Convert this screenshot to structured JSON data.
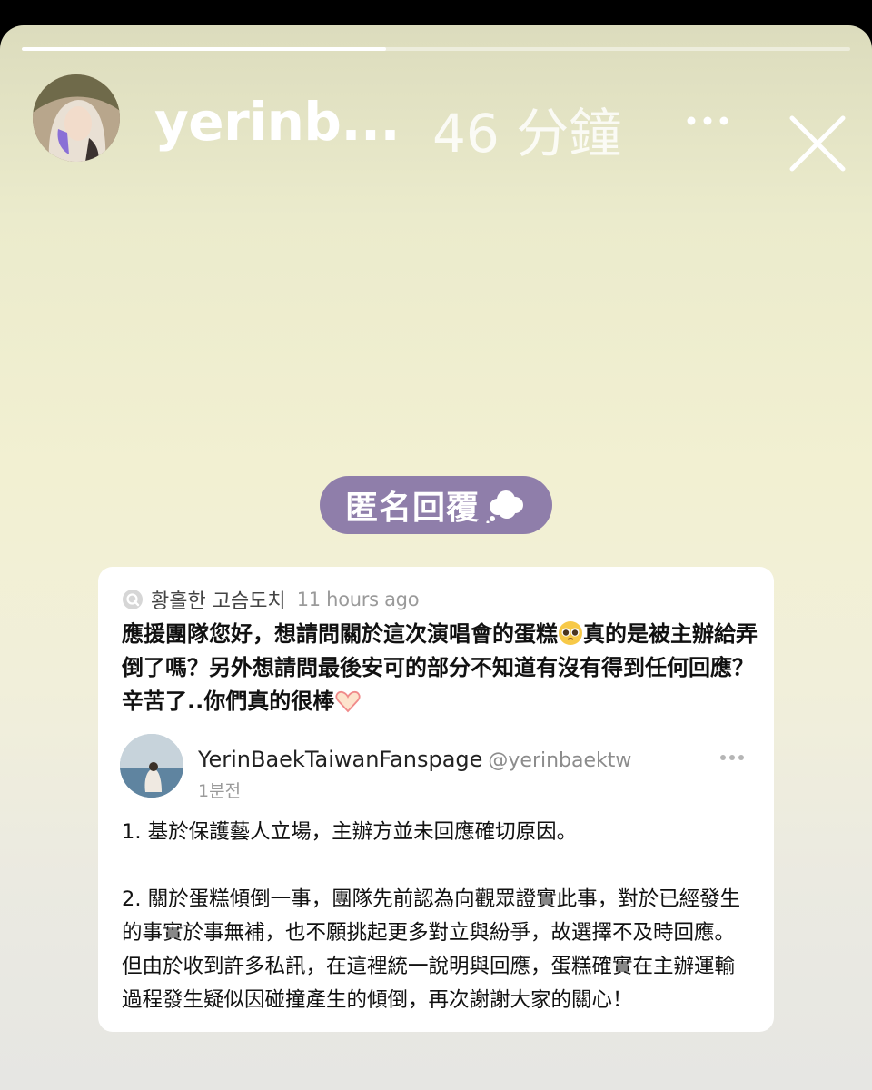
{
  "story": {
    "progress": 0.44,
    "username": "yerinb...",
    "time_ago": "46 分鐘",
    "icons": {
      "more": "more-horizontal-icon",
      "close": "close-icon"
    }
  },
  "sticker": {
    "label": "匿名回覆",
    "icon": "cloud-icon",
    "color": "#8f7eaa"
  },
  "card": {
    "question": {
      "icon": "q-icon",
      "author": "황홀한 고슴도치",
      "time": "11 hours ago",
      "text_part1": "應援團隊您好，想請問關於這次演唱會的蛋糕",
      "emoji1": "pleading-face-emoji",
      "text_part2": "真的是被主辦給弄倒了嗎？另外想請問最後安可的部分不知道有沒有得到任何回應？辛苦了..你們真的很棒",
      "emoji2": "heart-hands-emoji"
    },
    "reply": {
      "name": "YerinBaekTaiwanFanspage",
      "handle": "@yerinbaektw",
      "time": "1분전",
      "paragraph1": "1. 基於保護藝人立場，主辦方並未回應確切原因。",
      "paragraph2": "2. 關於蛋糕傾倒一事，團隊先前認為向觀眾證實此事，對於已經發生的事實於事無補，也不願挑起更多對立與紛爭，故選擇不及時回應。但由於收到許多私訊，在這裡統一說明與回應，蛋糕確實在主辦運輸過程發生疑似因碰撞產生的傾倒，再次謝謝大家的關心！"
    }
  }
}
